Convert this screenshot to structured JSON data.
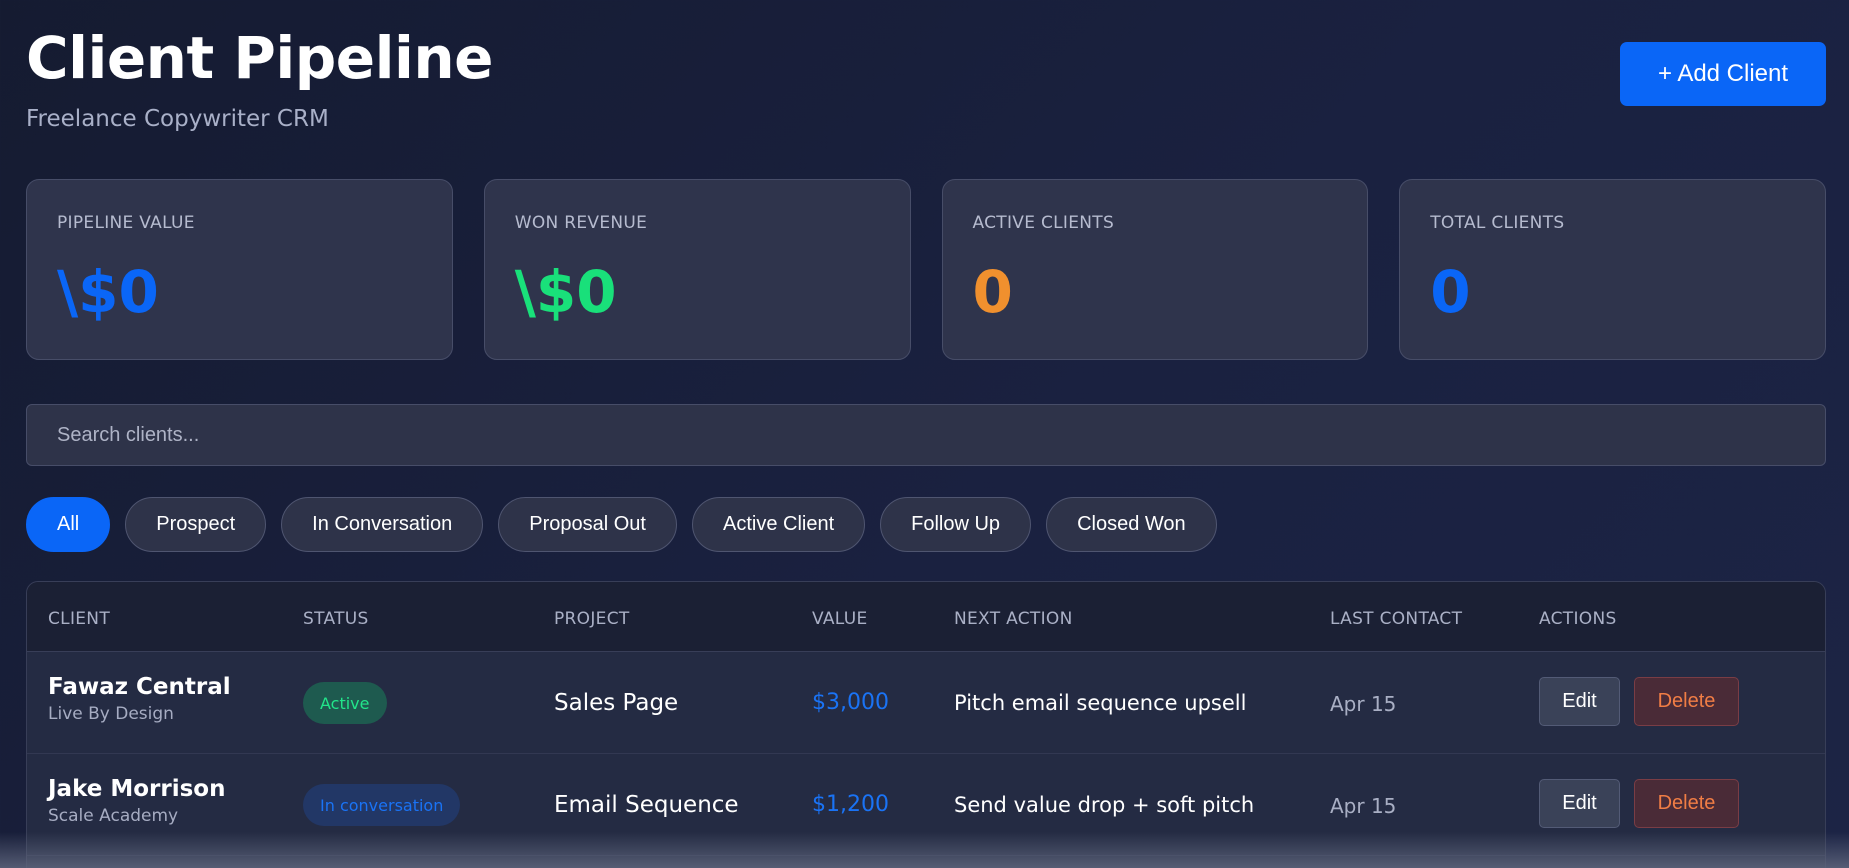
{
  "header": {
    "title": "Client Pipeline",
    "subtitle": "Freelance Copywriter CRM",
    "add_button": "+ Add Client"
  },
  "stats": [
    {
      "label": "PIPELINE VALUE",
      "value": "\\$0",
      "color": "#0a66f7"
    },
    {
      "label": "WON REVENUE",
      "value": "\\$0",
      "color": "#19e07a"
    },
    {
      "label": "ACTIVE CLIENTS",
      "value": "0",
      "color": "#f0902e"
    },
    {
      "label": "TOTAL CLIENTS",
      "value": "0",
      "color": "#0a66f7"
    }
  ],
  "search": {
    "placeholder": "Search clients..."
  },
  "filters": [
    "All",
    "Prospect",
    "In Conversation",
    "Proposal Out",
    "Active Client",
    "Follow Up",
    "Closed Won"
  ],
  "active_filter": "All",
  "table": {
    "columns": [
      "CLIENT",
      "STATUS",
      "PROJECT",
      "VALUE",
      "NEXT ACTION",
      "LAST CONTACT",
      "ACTIONS"
    ],
    "edit_label": "Edit",
    "delete_label": "Delete",
    "rows": [
      {
        "name": "Fawaz Central",
        "company": "Live By Design",
        "status": "Active",
        "project": "Sales Page",
        "value": "$3,000",
        "next_action": "Pitch email sequence upsell",
        "last_contact": "Apr 15"
      },
      {
        "name": "Jake Morrison",
        "company": "Scale Academy",
        "status": "In conversation",
        "project": "Email Sequence",
        "value": "$1,200",
        "next_action": "Send value drop + soft pitch",
        "last_contact": "Apr 15"
      }
    ]
  },
  "colors": {
    "accent": "#0a66f7",
    "status_active_bg": "#1e5a4f",
    "status_active_text": "#22e58a",
    "status_conversation_bg": "#223766",
    "status_conversation_text": "#1a73f5"
  }
}
